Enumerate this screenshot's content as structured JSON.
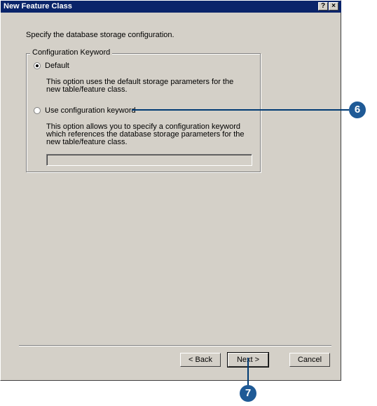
{
  "window": {
    "title": "New Feature Class",
    "help_label": "?",
    "close_label": "×"
  },
  "instruction": "Specify the database storage configuration.",
  "group": {
    "legend": "Configuration Keyword",
    "options": [
      {
        "label": "Default",
        "checked": true,
        "description": "This option uses the default storage parameters for the new table/feature class."
      },
      {
        "label": "Use configuration keyword",
        "checked": false,
        "description": "This option allows you to specify a configuration keyword which references the database storage parameters for the new table/feature class."
      }
    ],
    "keyword_value": ""
  },
  "buttons": {
    "back": "< Back",
    "next": "Next >",
    "cancel": "Cancel"
  },
  "callouts": {
    "step6": "6",
    "step7": "7",
    "color": "#1f5a96"
  }
}
